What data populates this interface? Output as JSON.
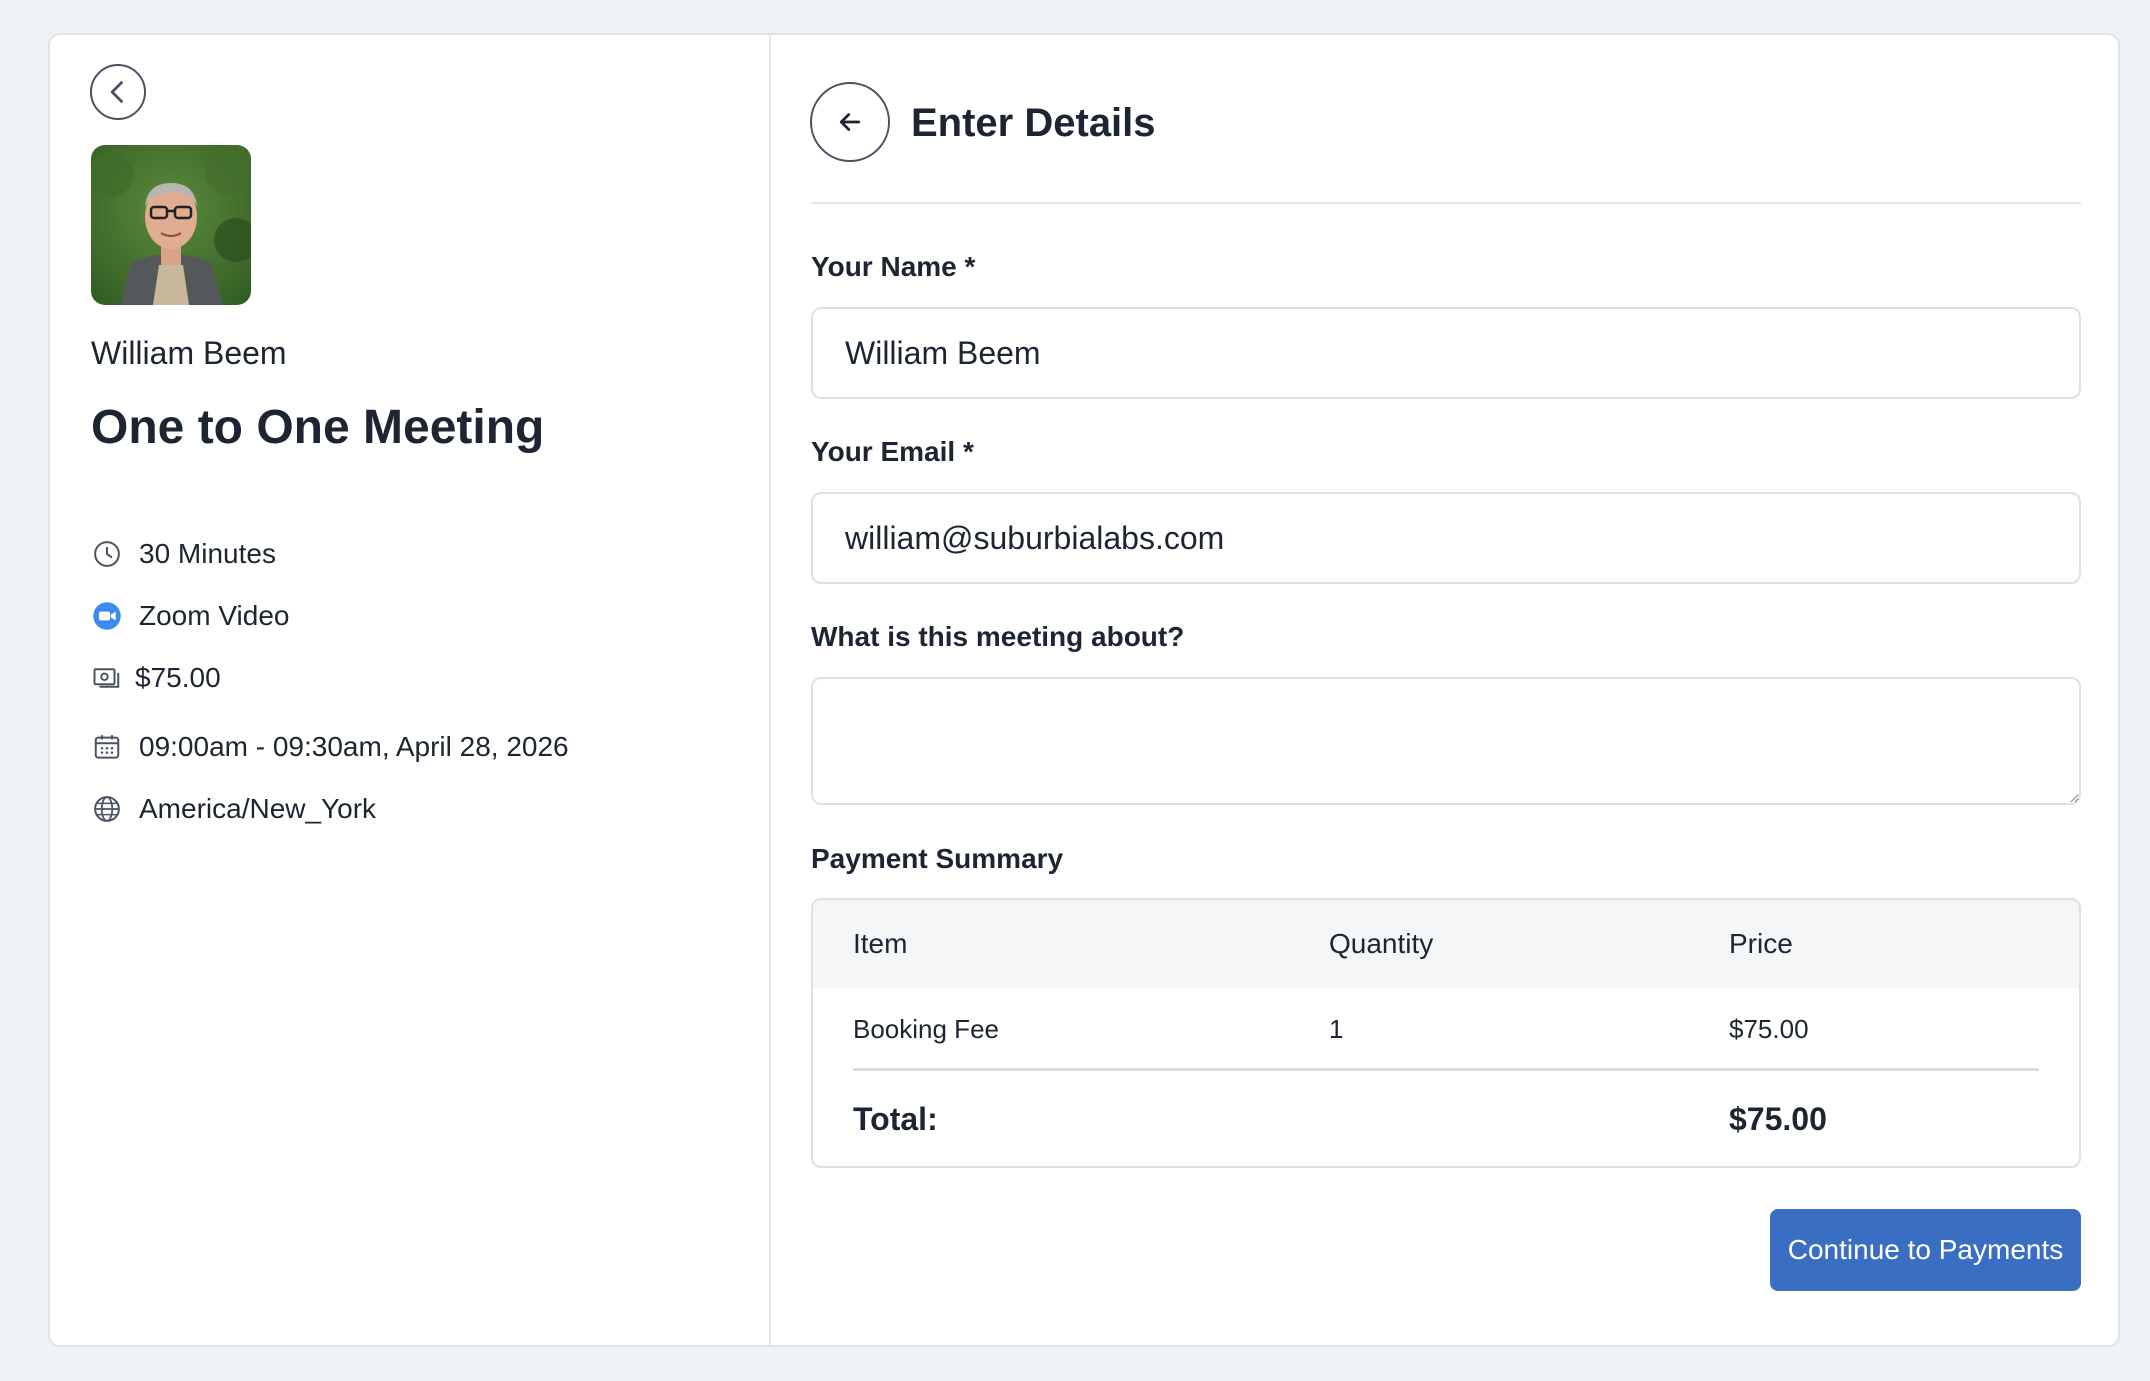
{
  "host": {
    "name": "William Beem"
  },
  "event": {
    "title": "One to One Meeting",
    "duration": "30 Minutes",
    "location": "Zoom Video",
    "price": "$75.00",
    "datetime": "09:00am - 09:30am, April 28, 2026",
    "timezone": "America/New_York"
  },
  "form": {
    "title": "Enter Details",
    "name_label": "Your Name *",
    "name_value": "William Beem",
    "email_label": "Your Email *",
    "email_value": "william@suburbialabs.com",
    "about_label": "What is this meeting about?",
    "about_value": ""
  },
  "payment": {
    "title": "Payment Summary",
    "headers": {
      "item": "Item",
      "quantity": "Quantity",
      "price": "Price"
    },
    "rows": [
      {
        "item": "Booking Fee",
        "quantity": "1",
        "price": "$75.00"
      }
    ],
    "total_label": "Total:",
    "total_value": "$75.00"
  },
  "cta_label": "Continue to Payments",
  "colors": {
    "accent": "#3a6ec2",
    "zoom": "#3d8bf0",
    "page_bg": "#f0f3f6"
  }
}
